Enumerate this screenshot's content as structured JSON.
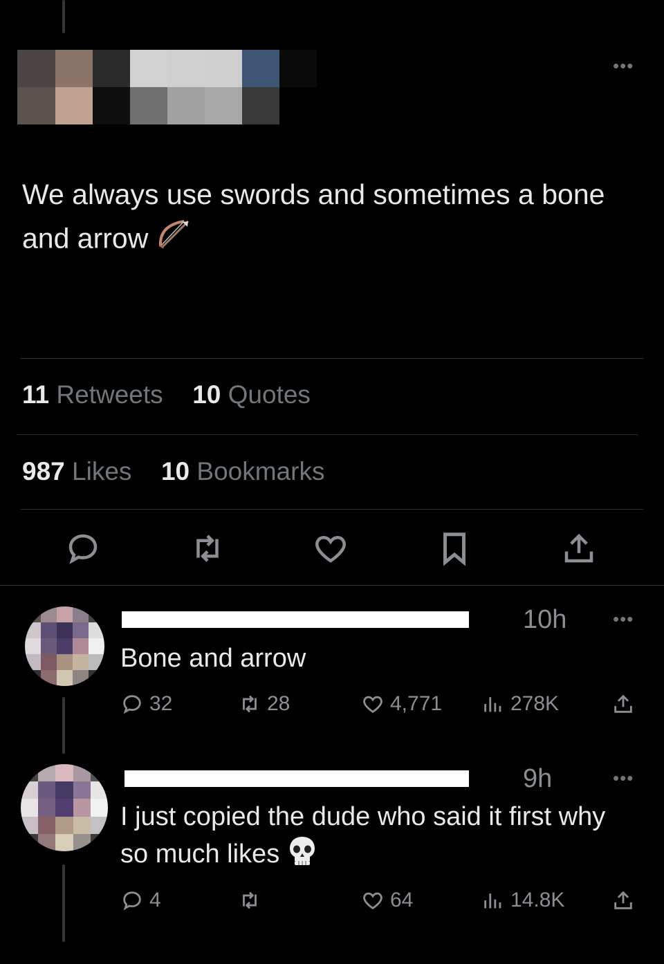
{
  "tweet": {
    "text": "We always use swords and sometimes a bone and arrow",
    "emoji": "bow-and-arrow",
    "more_label": "•••"
  },
  "stats": {
    "retweets_count": "11",
    "retweets_label": "Retweets",
    "quotes_count": "10",
    "quotes_label": "Quotes",
    "likes_count": "987",
    "likes_label": "Likes",
    "bookmarks_count": "10",
    "bookmarks_label": "Bookmarks"
  },
  "actions": [
    "reply-icon",
    "retweet-icon",
    "like-icon",
    "bookmark-icon",
    "share-icon"
  ],
  "replies": [
    {
      "time": "10h",
      "text": "Bone and arrow",
      "reply_count": "32",
      "retweet_count": "28",
      "like_count": "4,771",
      "view_count": "278K"
    },
    {
      "time": "9h",
      "text": "I just copied the dude who said it first why so much likes",
      "emoji": "skull",
      "reply_count": "4",
      "retweet_count": "",
      "like_count": "64",
      "view_count": "14.8K"
    }
  ],
  "colors": {
    "background": "#000000",
    "text": "#e7e9ea",
    "muted": "#71767b",
    "divider": "#2f3336"
  }
}
